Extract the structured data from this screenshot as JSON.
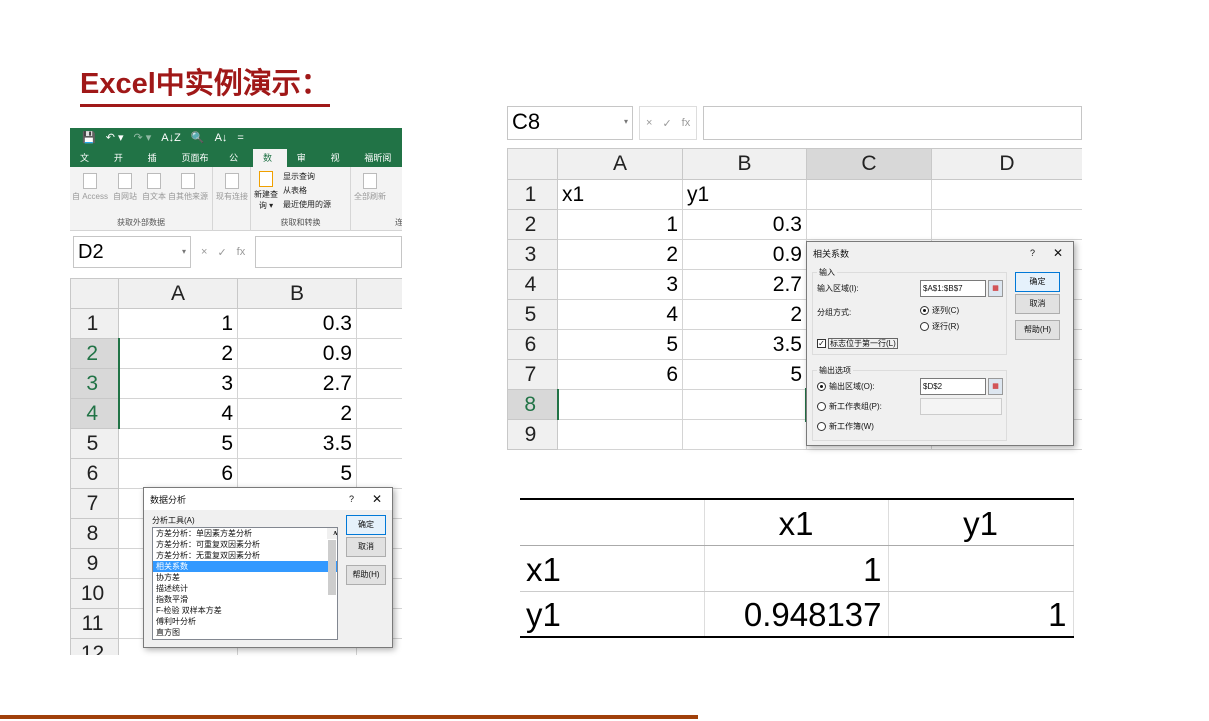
{
  "slide": {
    "title": "Excel中实例演示："
  },
  "left_excel": {
    "qat": [
      "💾",
      "↶ ▾",
      "↷ ▾",
      "A↓Z",
      "🔍",
      "A↓",
      "="
    ],
    "tabs": [
      "文件",
      "开始",
      "插入",
      "页面布局",
      "公式",
      "数据",
      "审阅",
      "视图",
      "福昕阅读"
    ],
    "active_tab": "数据",
    "ribbon": {
      "g1": {
        "items": [
          "自 Access",
          "自网站",
          "自文本",
          "自其他来源"
        ],
        "label": "获取外部数据"
      },
      "existing": "现有连接",
      "g2": {
        "new_query": "新建查询 ▾",
        "items": [
          "显示查询",
          "从表格",
          "最近使用的源"
        ],
        "label": "获取和转换"
      },
      "g3": {
        "refresh": "全部刷新",
        "label": "连接"
      }
    },
    "name_box": "D2",
    "fx": [
      "×",
      "✓",
      "fx"
    ],
    "columns": [
      "A",
      "B"
    ],
    "rows": [
      [
        "1",
        "1",
        "0.3"
      ],
      [
        "2",
        "2",
        "0.9"
      ],
      [
        "3",
        "3",
        "2.7"
      ],
      [
        "4",
        "4",
        "2"
      ],
      [
        "5",
        "5",
        "3.5"
      ],
      [
        "6",
        "6",
        "5"
      ],
      [
        "7",
        "",
        ""
      ],
      [
        "8",
        "",
        ""
      ],
      [
        "9",
        "",
        ""
      ],
      [
        "10",
        "",
        ""
      ],
      [
        "11",
        "",
        ""
      ],
      [
        "12",
        "",
        ""
      ]
    ],
    "dialog": {
      "title": "数据分析",
      "help": "?",
      "close": "✕",
      "tools_label": "分析工具(A)",
      "items": [
        "方差分析：单因素方差分析",
        "方差分析：可重复双因素分析",
        "方差分析：无重复双因素分析",
        "相关系数",
        "协方差",
        "描述统计",
        "指数平滑",
        "F-检验 双样本方差",
        "傅利叶分析",
        "直方图"
      ],
      "selected": "相关系数",
      "ok": "确定",
      "cancel": "取消",
      "help_btn": "帮助(H)"
    }
  },
  "right_excel": {
    "name_box": "C8",
    "fx": [
      "×",
      "✓",
      "fx"
    ],
    "columns": [
      "A",
      "B",
      "C",
      "D"
    ],
    "rows": [
      [
        "1",
        "x1",
        "y1"
      ],
      [
        "2",
        "1",
        "0.3"
      ],
      [
        "3",
        "2",
        "0.9"
      ],
      [
        "4",
        "3",
        "2.7"
      ],
      [
        "5",
        "4",
        "2"
      ],
      [
        "6",
        "5",
        "3.5"
      ],
      [
        "7",
        "6",
        "5"
      ],
      [
        "8",
        "",
        ""
      ],
      [
        "9",
        "",
        ""
      ]
    ],
    "dialog": {
      "title": "相关系数",
      "help": "?",
      "close": "✕",
      "input_group": "输入",
      "input_range_label": "输入区域(I):",
      "input_range": "$A$1:$B$7",
      "group_by_label": "分组方式:",
      "by_col": "逐列(C)",
      "by_row": "逐行(R)",
      "labels_first_row": "标志位于第一行(L)",
      "output_group": "输出选项",
      "output_range_label": "输出区域(O):",
      "output_range": "$D$2",
      "new_sheet": "新工作表组(P):",
      "new_book": "新工作簿(W)",
      "ok": "确定",
      "cancel": "取消",
      "help_btn": "帮助(H)"
    }
  },
  "result_table": {
    "rows": [
      [
        "",
        "x1",
        "y1"
      ],
      [
        "x1",
        "1",
        ""
      ],
      [
        "y1",
        "0.948137",
        "1"
      ]
    ]
  }
}
